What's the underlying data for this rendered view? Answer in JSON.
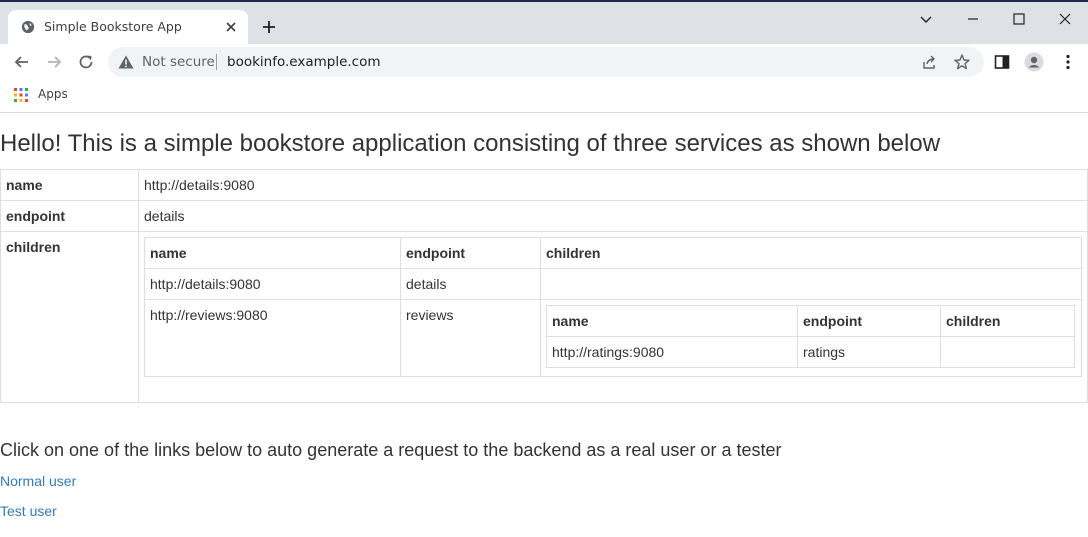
{
  "browser": {
    "tab_title": "Simple Bookstore App",
    "security_label": "Not secure",
    "url": "bookinfo.example.com",
    "bookmarks": [
      {
        "label": "Apps"
      }
    ]
  },
  "page": {
    "heading": "Hello! This is a simple bookstore application consisting of three services as shown below",
    "table": {
      "labels": {
        "name": "name",
        "endpoint": "endpoint",
        "children": "children"
      },
      "name": "http://details:9080",
      "endpoint": "details",
      "children_table": {
        "headers": [
          "name",
          "endpoint",
          "children"
        ],
        "rows": [
          {
            "name": "http://details:9080",
            "endpoint": "details"
          },
          {
            "name": "http://reviews:9080",
            "endpoint": "reviews",
            "children_table": {
              "headers": [
                "name",
                "endpoint",
                "children"
              ],
              "rows": [
                {
                  "name": "http://ratings:9080",
                  "endpoint": "ratings"
                }
              ]
            }
          }
        ]
      }
    },
    "instructions": "Click on one of the links below to auto generate a request to the backend as a real user or a tester",
    "links": [
      "Normal user",
      "Test user"
    ]
  },
  "colors": {
    "link": "#337ab7",
    "tab_strip": "#dee1e6",
    "omnibox": "#f1f3f4"
  }
}
